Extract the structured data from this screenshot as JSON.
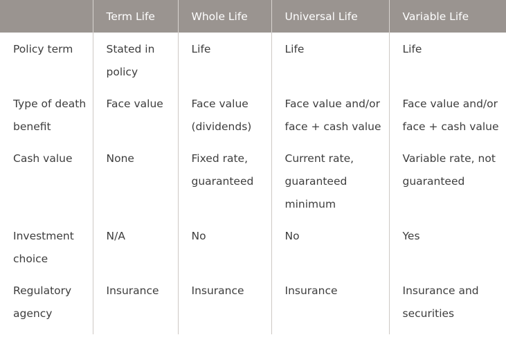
{
  "headers": [
    "",
    "Term Life",
    "Whole Life",
    "Universal Life",
    "Variable Life"
  ],
  "rows": [
    [
      "Policy term",
      "Stated in policy",
      "Life",
      "Life",
      "Life"
    ],
    [
      "Type of death benefit",
      "Face value",
      "Face value (dividends)",
      "Face value and/or face + cash value",
      "Face value and/or face + cash value"
    ],
    [
      "Cash value",
      "None",
      "Fixed rate, guaranteed",
      "Current rate, guaranteed minimum",
      "Variable rate, not guaranteed"
    ],
    [
      "Investment choice",
      "N/A",
      "No",
      "No",
      "Yes"
    ],
    [
      "Regulatory agency",
      "Insurance",
      "Insurance",
      "Insurance",
      "Insurance and securities"
    ]
  ],
  "colors": {
    "header_bg": "#9a9490",
    "header_text": "#ffffff",
    "body_text": "#3d3d3d"
  }
}
